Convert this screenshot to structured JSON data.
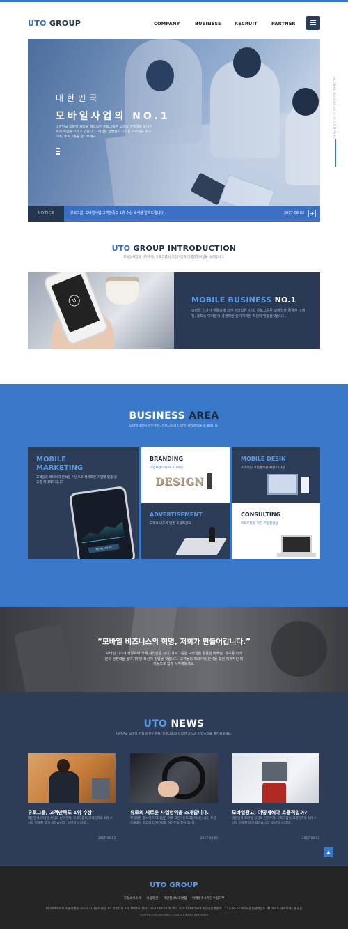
{
  "header": {
    "logo_prefix": "UTO",
    "logo_suffix": " GROUP",
    "nav": [
      "COMPANY",
      "BUSINESS",
      "RECRUIT",
      "PARTNER"
    ],
    "menu_icon": "hamburger-icon"
  },
  "hero": {
    "kicker": "대한민국",
    "headline": "모바일사업의 NO.1",
    "description": "대한민국 모바일 사업을 책임지는 유토그룹은 고객의 경쟁력을 높이기 위해 최선을 다하고 있습니다. 세상을 한발앞서 나가는 모바일을 추구하며, 유토그룹을 만나보세요.",
    "side_text": "GLOBAL BUSINESS UTO COMPANY",
    "notice": {
      "label": "NOTICE",
      "text": "유토그룹, 모바일사업 고객만족도 1위 수상 소식을 알려드립니다.",
      "date": "2017-08-03",
      "more_icon": "plus-icon"
    }
  },
  "intro": {
    "title_prefix": "UTO",
    "title_suffix": " GROUP INTRODUCTION",
    "subtitle": "모바일사업의 선두주자, 유토그룹의 기업비전과 그룹경영이념을 소개합니다.",
    "phone_logo": "U",
    "mobile_title_a": "MOBILE BUSINESS ",
    "mobile_title_b": "NO.1",
    "mobile_body": "모바일 기기가 생활속에 크게 자리잡은 시대, 유토그룹은 모바일을 활용한 마케팅, 홍보등 여러분의 경쟁력을 높이기위한 최선의 방법을찾습니다."
  },
  "business": {
    "title_a": "BUSINESS",
    "title_b": " AREA",
    "subtitle": "모바일사업의 선두주자, 유토그룹의 다양한 사업영역을 소개합니다.",
    "cards": [
      {
        "title": "MOBILE MARKETING",
        "desc": "고객들의 빅데이터 분석을 기반으로 체계화된 기업별 맞춤 광고를 제작해드립니다.",
        "phone_label": "TOTAL VALUE"
      },
      {
        "title": "BRANDING",
        "desc": "기업브랜드화/로고디자인",
        "art": "DESIGN"
      },
      {
        "title": "MOBILE DESIN",
        "desc": "효과적인 기업홍보를 위한 디자인"
      },
      {
        "title": "ADVERTISEMENT",
        "desc": "고객의 니즈에 맞춘 효율적광고"
      },
      {
        "title": "CONSULTING",
        "desc": "목표도달을 위한 기업컨설팅"
      }
    ]
  },
  "quote": {
    "text": "“모바일 비즈니스의 혁명, 저희가 만들어갑니다.”",
    "body": "모바일 기기가 생활속에 크게 자리잡은 시대, 유토그룹은 모바일을 활용한 마케팅, 홍보등 여러분의 경쟁력을 높이기위한 최선의 방법을 찾습니다. 고객들의 빅데이터 분석을 통한 체계적인 마케팅으로 함께 시작해보세요."
  },
  "news": {
    "title_a": "UTO",
    "title_b": " NEWS",
    "subtitle": "대한민국 모바일 사업의 선두주자, 유토그룹의 다양한 소식과 사업소식을 확인해보세요.",
    "items": [
      {
        "title": "유토그룹, 고객만족도 1위 수상",
        "body": "대한민국 모바일 사업의 선두주자, 유토그룹이 고객만족도 1위 수상의 영예를 얻게 되었습니다. 모바일 사업의...",
        "date": "2017-08-03"
      },
      {
        "title": "유토의 새로운 사업영역을 소개합니다.",
        "body": "획일화된 웹사이트 디자인은 이제 그만! 유토그룹에서는 최신 트렌드에맞는 최고의 디자인으로 여러분을 찾아갑니다.",
        "date": "2017-08-03"
      },
      {
        "title": "모바일광고, 어떻게해야 효율적일까?",
        "body": "대한민국 모바일 사업의 선두주자, 유토그룹이 고객만족도 1위 수상의 영예를 얻게 되었습니다. 모바일 사업의...",
        "date": "2017-08-03"
      }
    ],
    "top_button": "TOP"
  },
  "footer": {
    "logo": "UTO GROUP",
    "links": [
      "기업소개소개",
      "이용약관",
      "개인정보보호방침",
      "이메일주소무단수집거부"
    ],
    "address": "(주)에프지아이 서울특별시 구로구 디지털로26길 61 유토타워 2차 1004호  전화 : 02-1234-5678  팩스 : 02-1234-5678  사업자등록번호 : 123-56-123456  통신판매번호 제1004호  대표이사 : 홍길동",
    "copyright": "COPYRIGHT(C)UTOMALL.COM ALL RIGHT RESERVED"
  }
}
